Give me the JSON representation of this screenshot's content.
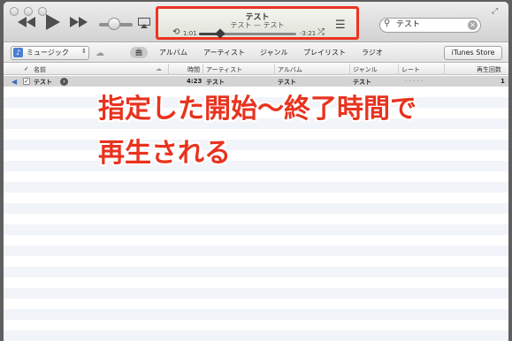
{
  "player": {
    "track_title": "テスト",
    "track_subtitle": "テスト — テスト",
    "elapsed": "1:01",
    "remaining": "-3:21",
    "progress": 0.22
  },
  "search": {
    "value": "テスト"
  },
  "nav": {
    "library": "ミュージック",
    "tabs": [
      "曲",
      "アルバム",
      "アーティスト",
      "ジャンル",
      "プレイリスト",
      "ラジオ"
    ],
    "store": "iTunes Store"
  },
  "table": {
    "headers": {
      "name": "名前",
      "time": "時間",
      "artist": "アーティスト",
      "album": "アルバム",
      "genre": "ジャンル",
      "rating": "レート",
      "plays": "再生回数"
    },
    "rows": [
      {
        "name": "テスト",
        "time": "4:23",
        "artist": "テスト",
        "album": "テスト",
        "genre": "テスト",
        "rating": "· · · · ·",
        "plays": "1"
      }
    ]
  },
  "overlay": {
    "line1": "指定した開始〜終了時間で",
    "line2": "再生される"
  },
  "colors": {
    "accent": "#ee3322",
    "selection": "#d4d4d4"
  },
  "icons": [
    "rewind-icon",
    "play-icon",
    "fast-forward-icon",
    "volume-slider",
    "airplay-icon",
    "repeat-icon",
    "shuffle-icon",
    "list-icon",
    "search-icon",
    "cloud-icon",
    "music-note-icon",
    "speaker-icon"
  ]
}
